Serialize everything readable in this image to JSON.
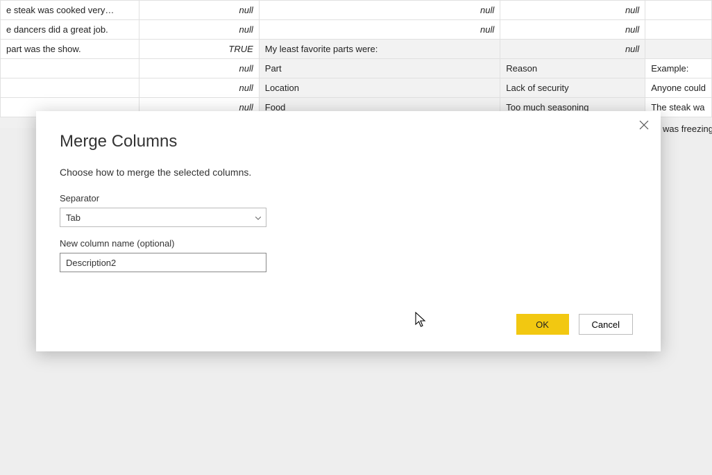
{
  "grid": {
    "rows": [
      {
        "a": "e steak was cooked very…",
        "b": "null",
        "b_class": "null-cell",
        "c": "null",
        "c_class": "null-cell",
        "d": "null",
        "d_class": "null-cell",
        "e": ""
      },
      {
        "a": "e dancers did a great job.",
        "b": "null",
        "b_class": "null-cell",
        "c": "null",
        "c_class": "null-cell",
        "d": "null",
        "d_class": "null-cell",
        "e": ""
      },
      {
        "a": "part was the show.",
        "b": "TRUE",
        "b_class": "true-cell",
        "c": "My least favorite parts were:",
        "c_class": "shaded",
        "d": "null",
        "d_class": "null-cell shaded",
        "e": "",
        "e_class": "shaded"
      },
      {
        "a": "",
        "b": "null",
        "b_class": "null-cell",
        "c": "Part",
        "c_class": "shaded",
        "d": "Reason",
        "d_class": "shaded",
        "e": "Example:"
      },
      {
        "a": "",
        "b": "null",
        "b_class": "null-cell",
        "c": "Location",
        "c_class": "shaded",
        "d": "Lack of security",
        "d_class": "shaded",
        "e": "Anyone could"
      },
      {
        "a": "",
        "b": "null",
        "b_class": "null-cell",
        "c": "Food",
        "c_class": "shaded",
        "d": "Too much seasoning",
        "d_class": "shaded",
        "e": "The steak wa"
      }
    ],
    "trailing_text": "was freezing"
  },
  "dialog": {
    "title": "Merge Columns",
    "subtitle": "Choose how to merge the selected columns.",
    "separator_label": "Separator",
    "separator_value": "Tab",
    "newcol_label": "New column name (optional)",
    "newcol_value": "Description2",
    "ok": "OK",
    "cancel": "Cancel"
  }
}
